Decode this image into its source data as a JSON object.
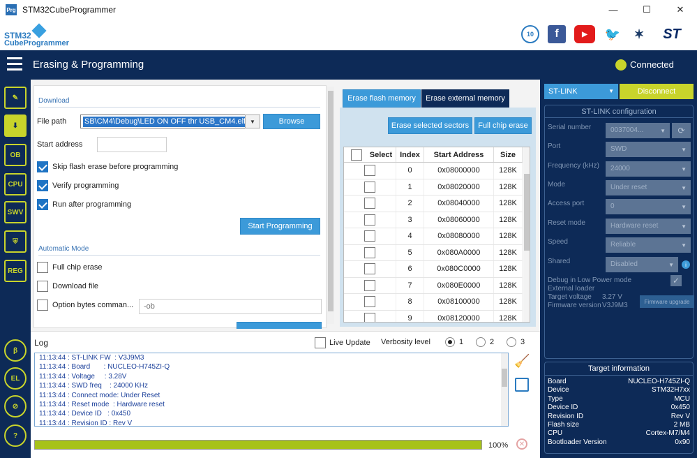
{
  "app": {
    "title": "STM32CubeProgrammer",
    "icon_text": "Prg"
  },
  "window_controls": {
    "minimize": "—",
    "maximize": "☐",
    "close": "✕"
  },
  "logo": {
    "line1": "STM32",
    "line2": "CubeProgrammer"
  },
  "social": {
    "anniv": "10",
    "fb": "f",
    "yt": "▶",
    "tw": "🐦",
    "net": "✶",
    "st": "ST"
  },
  "header": {
    "title": "Erasing & Programming",
    "status": "Connected",
    "status_color": "#c8d42b"
  },
  "sidebar": [
    "✎",
    "⬇",
    "OB",
    "CPU",
    "SWV",
    "⛨",
    "REG",
    "β",
    "EL",
    "⊘",
    "?"
  ],
  "download": {
    "section_title": "Download",
    "file_path_label": "File path",
    "file_path_value": "SB\\CM4\\Debug\\LED ON OFF thr USB_CM4.elf",
    "browse_label": "Browse",
    "start_address_label": "Start address",
    "skip_flash_erase_label": "Skip flash erase before programming",
    "verify_label": "Verify programming",
    "run_after_label": "Run after programming",
    "start_programming_label": "Start Programming"
  },
  "automatic": {
    "section_title": "Automatic Mode",
    "full_chip_erase_label": "Full chip erase",
    "download_file_label": "Download file",
    "option_bytes_label": "Option bytes comman...",
    "option_bytes_placeholder": "-ob"
  },
  "erase": {
    "tab_flash": "Erase flash memory",
    "tab_external": "Erase external memory",
    "erase_selected_label": "Erase selected sectors",
    "full_chip_erase_label": "Full chip erase",
    "columns": [
      "Select",
      "Index",
      "Start Address",
      "Size"
    ],
    "rows": [
      {
        "index": "0",
        "address": "0x08000000",
        "size": "128K"
      },
      {
        "index": "1",
        "address": "0x08020000",
        "size": "128K"
      },
      {
        "index": "2",
        "address": "0x08040000",
        "size": "128K"
      },
      {
        "index": "3",
        "address": "0x08060000",
        "size": "128K"
      },
      {
        "index": "4",
        "address": "0x08080000",
        "size": "128K"
      },
      {
        "index": "5",
        "address": "0x080A0000",
        "size": "128K"
      },
      {
        "index": "6",
        "address": "0x080C0000",
        "size": "128K"
      },
      {
        "index": "7",
        "address": "0x080E0000",
        "size": "128K"
      },
      {
        "index": "8",
        "address": "0x08100000",
        "size": "128K"
      },
      {
        "index": "9",
        "address": "0x08120000",
        "size": "128K"
      }
    ]
  },
  "log": {
    "title": "Log",
    "live_update_label": "Live Update",
    "verbosity_label": "Verbosity level",
    "verbosity_options": [
      "1",
      "2",
      "3"
    ],
    "lines": [
      "11:13:44 : ST-LINK FW  : V3J9M3",
      "11:13:44 : Board       : NUCLEO-H745ZI-Q",
      "11:13:44 : Voltage     : 3.28V",
      "11:13:44 : SWD freq    : 24000 KHz",
      "11:13:44 : Connect mode: Under Reset",
      "11:13:44 : Reset mode  : Hardware reset",
      "11:13:44 : Device ID   : 0x450",
      "11:13:44 : Revision ID : Rev V"
    ],
    "progress_percent": 100,
    "progress_text": "100%"
  },
  "stlink": {
    "selector": "ST-LINK",
    "disconnect_label": "Disconnect",
    "config_title": "ST-LINK configuration",
    "serial_label": "Serial number",
    "serial_value": "0037004...",
    "port_label": "Port",
    "port_value": "SWD",
    "freq_label": "Frequency (kHz)",
    "freq_value": "24000",
    "mode_label": "Mode",
    "mode_value": "Under reset",
    "access_port_label": "Access port",
    "access_port_value": "0",
    "reset_mode_label": "Reset mode",
    "reset_mode_value": "Hardware reset",
    "speed_label": "Speed",
    "speed_value": "Reliable",
    "shared_label": "Shared",
    "shared_value": "Disabled",
    "debug_low_power_label": "Debug in Low Power mode",
    "external_loader_label": "External loader",
    "target_voltage_label": "Target voltage",
    "target_voltage_value": "3.27 V",
    "firmware_label": "Firmware version",
    "firmware_value": "V3J9M3",
    "firmware_upgrade_label": "Firmware upgrade"
  },
  "target": {
    "title": "Target information",
    "rows": [
      {
        "k": "Board",
        "v": "NUCLEO-H745ZI-Q"
      },
      {
        "k": "Device",
        "v": "STM32H7xx"
      },
      {
        "k": "Type",
        "v": "MCU"
      },
      {
        "k": "Device ID",
        "v": "0x450"
      },
      {
        "k": "Revision ID",
        "v": "Rev V"
      },
      {
        "k": "Flash size",
        "v": "2 MB"
      },
      {
        "k": "CPU",
        "v": "Cortex-M7/M4"
      },
      {
        "k": "Bootloader Version",
        "v": "0x90"
      }
    ]
  }
}
